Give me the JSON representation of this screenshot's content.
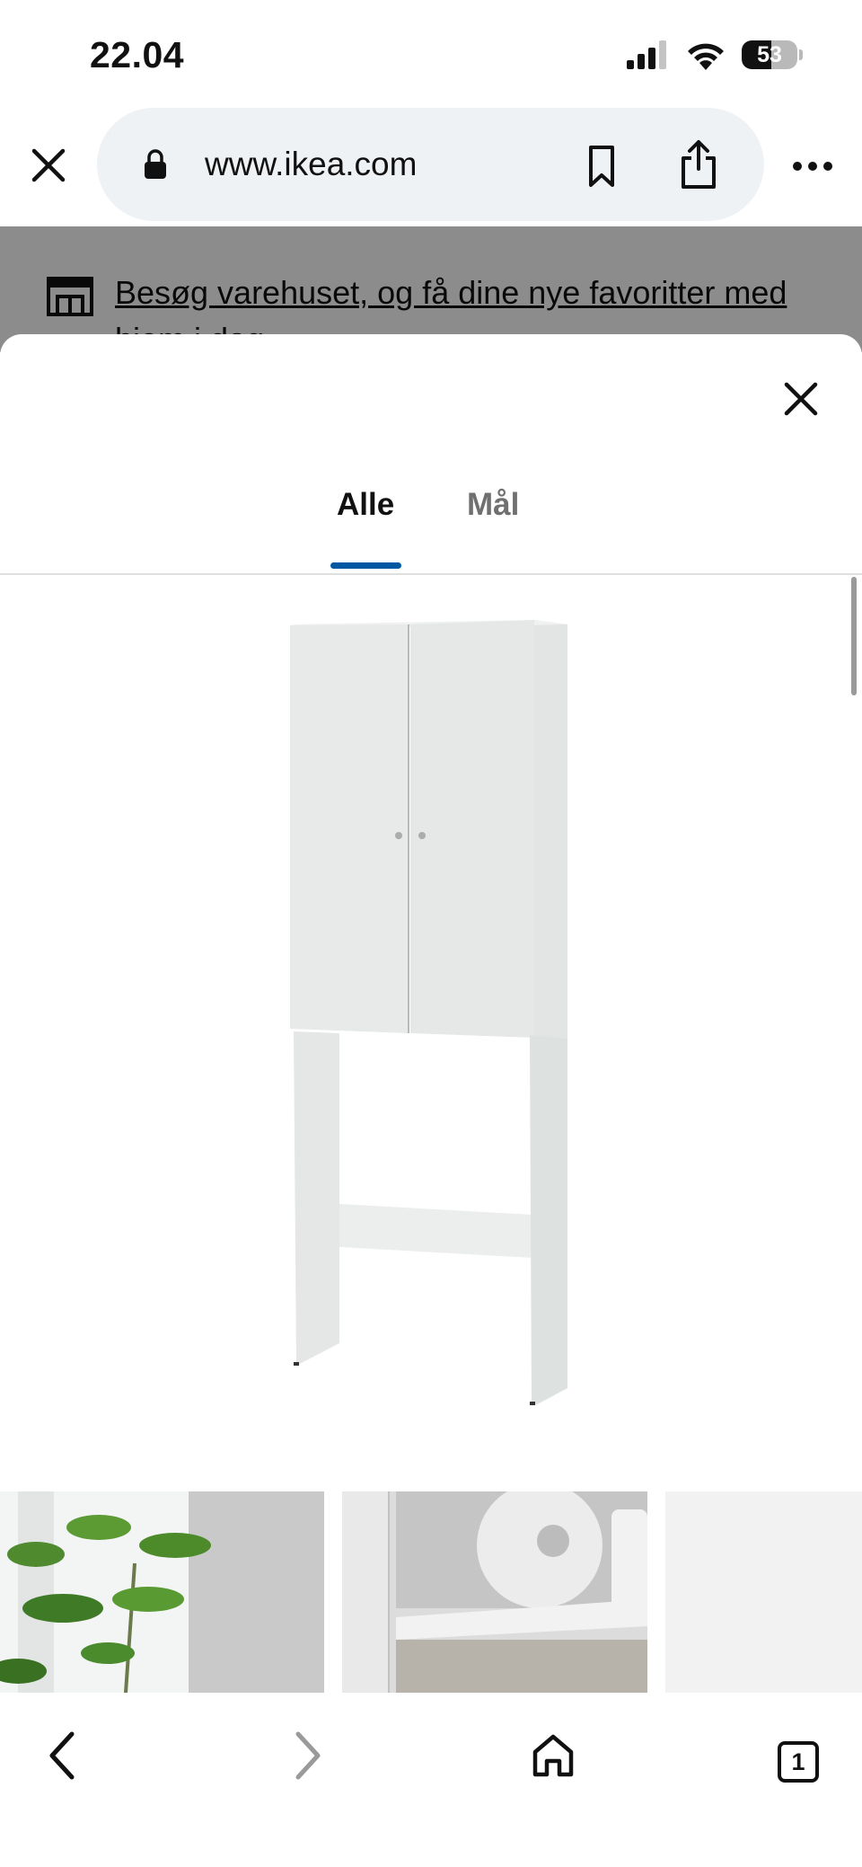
{
  "status": {
    "time": "22.04",
    "battery_percent": 53,
    "battery_label": "53"
  },
  "browser": {
    "url": "www.ikea.com"
  },
  "banner": {
    "text": "Besøg varehuset, og få dine nye favoritter med hjem i dag"
  },
  "sheet": {
    "tabs": [
      {
        "label": "Alle",
        "selected": true
      },
      {
        "label": "Mål",
        "selected": false
      }
    ],
    "accent_color": "#0058a3"
  },
  "icons": {
    "close": "close-icon",
    "lock": "lock-icon",
    "bookmark": "bookmark-icon",
    "share": "share-icon",
    "more": "more-icon",
    "store": "store-icon",
    "back": "chevron-left-icon",
    "forward": "chevron-right-icon",
    "home": "home-icon"
  },
  "toolbar": {
    "tabs_count": "1"
  }
}
